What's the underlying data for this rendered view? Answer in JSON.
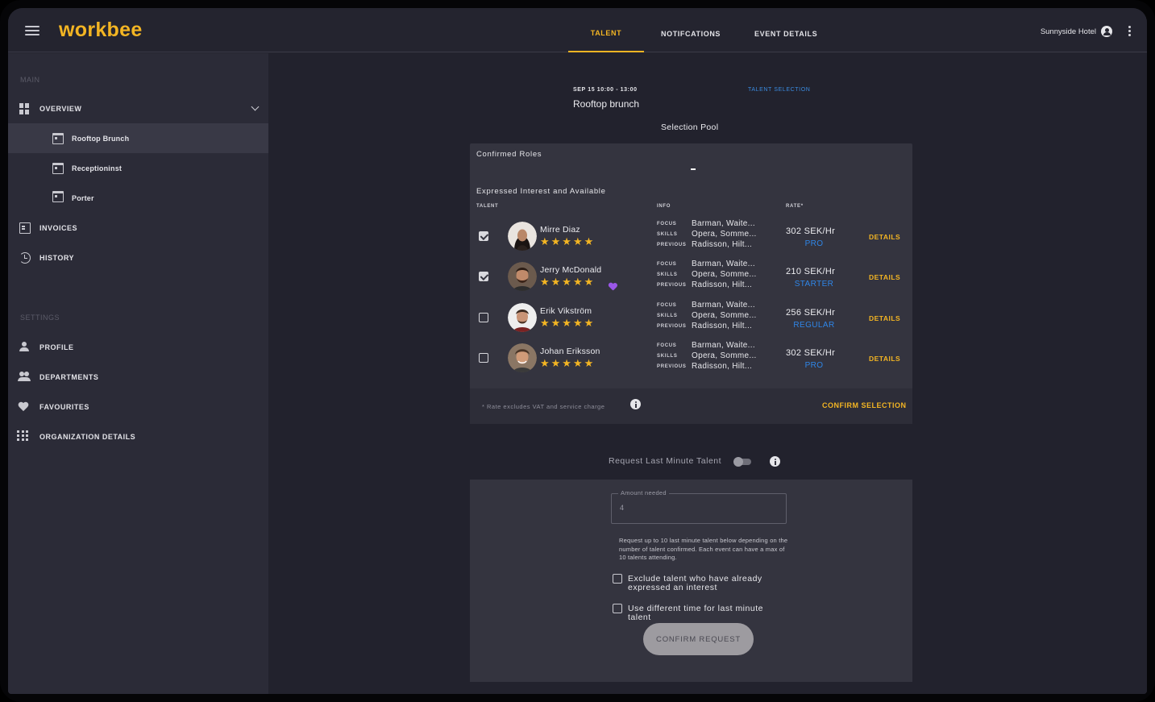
{
  "app": {
    "logo": "workbee"
  },
  "tabs": [
    {
      "label": "TALENT",
      "active": true
    },
    {
      "label": "NOTIFCATIONS",
      "active": false
    },
    {
      "label": "EVENT DETAILS",
      "active": false
    }
  ],
  "user": {
    "name": "Sunnyside Hotel"
  },
  "sidebar": {
    "main_label": "MAIN",
    "settings_label": "SETTINGS",
    "overview": "OVERVIEW",
    "events": [
      "Rooftop Brunch",
      "Receptioninst",
      "Porter"
    ],
    "invoices": "INVOICES",
    "history": "HISTORY",
    "profile": "PROFILE",
    "departments": "DEPARTMENTS",
    "favourites": "FAVOURITES",
    "organization": "ORGANIZATION DETAILS"
  },
  "event": {
    "date": "SEP 15 10:00 - 13:00",
    "name": "Rooftop brunch",
    "status": "TALENT SELECTION"
  },
  "pool": {
    "title": "Selection Pool",
    "confirmed_roles_label": "Confirmed Roles",
    "confirmed_roles_value": "-",
    "interest_label": "Expressed Interest and Available",
    "headers": {
      "talent": "TALENT",
      "info": "INFO",
      "rate": "RATE*"
    },
    "info_keys": {
      "focus": "FOCUS",
      "skills": "SKILLS",
      "previous": "PREVIOUS"
    },
    "details_label": "DETAILS",
    "footnote": "* Rate excludes VAT and service charge",
    "confirm_label": "CONFIRM SELECTION",
    "talents": [
      {
        "name": "Mirre Diaz",
        "checked": true,
        "stars": "★★★★★",
        "rating": 4.5,
        "favourite": false,
        "focus": "Barman, Waite...",
        "skills": "Opera, Somme...",
        "previous": "Radisson, Hilt...",
        "rate": "302 SEK/Hr",
        "tier": "PRO"
      },
      {
        "name": "Jerry McDonald",
        "checked": true,
        "stars": "★★★★★",
        "rating": 4.5,
        "favourite": true,
        "focus": "Barman, Waite...",
        "skills": "Opera, Somme...",
        "previous": "Radisson, Hilt...",
        "rate": "210 SEK/Hr",
        "tier": "STARTER"
      },
      {
        "name": "Erik Vikström",
        "checked": false,
        "stars": "★★★★★",
        "rating": 4.5,
        "favourite": false,
        "focus": "Barman, Waite...",
        "skills": "Opera, Somme...",
        "previous": "Radisson, Hilt...",
        "rate": "256 SEK/Hr",
        "tier": "REGULAR"
      },
      {
        "name": "Johan Eriksson",
        "checked": false,
        "stars": "★★★★★",
        "rating": 4.5,
        "favourite": false,
        "focus": "Barman, Waite...",
        "skills": "Opera, Somme...",
        "previous": "Radisson, Hilt...",
        "rate": "302 SEK/Hr",
        "tier": "PRO"
      }
    ]
  },
  "last_minute": {
    "label": "Request Last Minute Talent",
    "toggle_on": false,
    "amount_label": "Amount needed",
    "amount_value": "4",
    "help": "Request up to 10 last minute talent below depending on the number of talent confirmed. Each event can have a max of 10 talents attending.",
    "exclude_label": "Exclude talent who have already expressed an interest",
    "different_time_label": "Use different time for last minute talent",
    "confirm_label": "CONFIRM REQUEST"
  },
  "colors": {
    "accent": "#f3b523",
    "link_blue": "#2f86e8",
    "favourite": "#9a57e8"
  }
}
